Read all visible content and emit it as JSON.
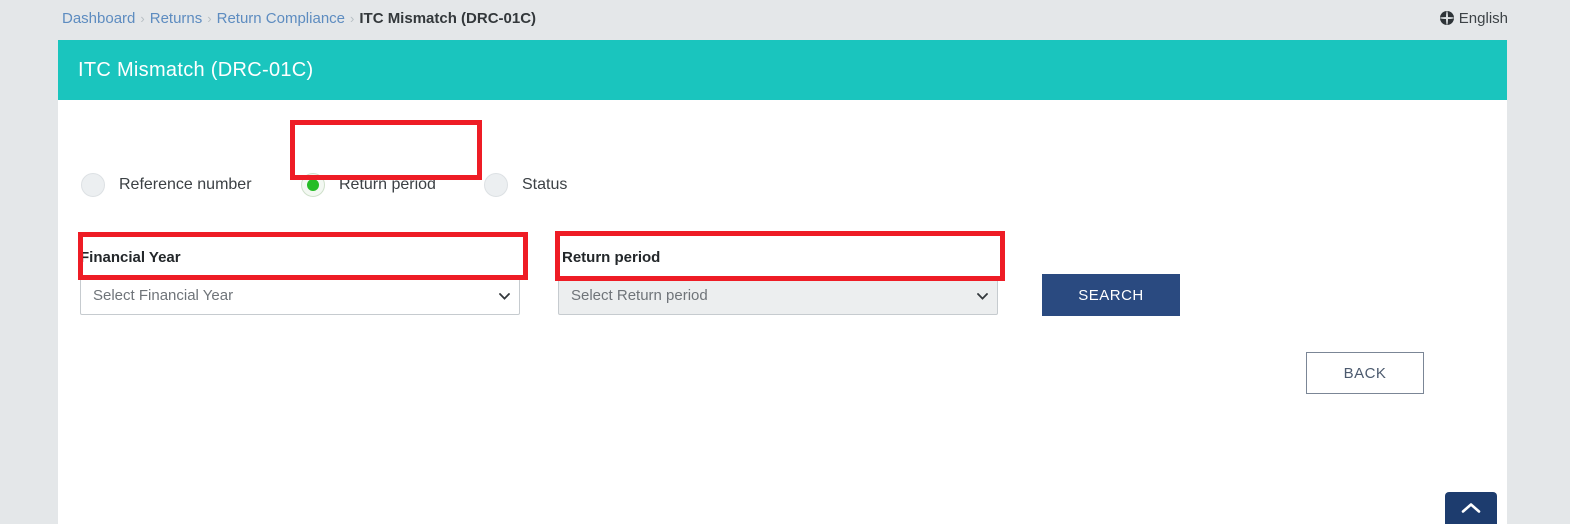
{
  "breadcrumb": {
    "items": [
      {
        "label": "Dashboard",
        "current": false
      },
      {
        "label": "Returns",
        "current": false
      },
      {
        "label": "Return Compliance",
        "current": false
      },
      {
        "label": "ITC Mismatch (DRC-01C)",
        "current": true
      }
    ],
    "separator": "›"
  },
  "language": {
    "icon": "globe-icon",
    "label": "English"
  },
  "card": {
    "title": "ITC Mismatch (DRC-01C)",
    "header_color": "#1ac5be"
  },
  "search_by": {
    "options": [
      {
        "id": "reference-number",
        "label": "Reference number",
        "selected": false
      },
      {
        "id": "return-period",
        "label": "Return period",
        "selected": true
      },
      {
        "id": "status",
        "label": "Status",
        "selected": false
      }
    ],
    "selected_color": "#25bd26"
  },
  "form": {
    "financial_year": {
      "label": "Financial Year",
      "value": "Select Financial Year",
      "disabled": false
    },
    "return_period": {
      "label": "Return period",
      "value": "Select Return period",
      "disabled": true
    }
  },
  "buttons": {
    "search": "SEARCH",
    "search_color": "#2a4a80",
    "back": "BACK",
    "scroll_top_icon": "chevron-up-icon"
  },
  "annotations": {
    "color": "#ee1c25",
    "boxes": [
      {
        "target": "return-period-radio"
      },
      {
        "target": "financial-year-select"
      },
      {
        "target": "return-period-select"
      }
    ]
  }
}
